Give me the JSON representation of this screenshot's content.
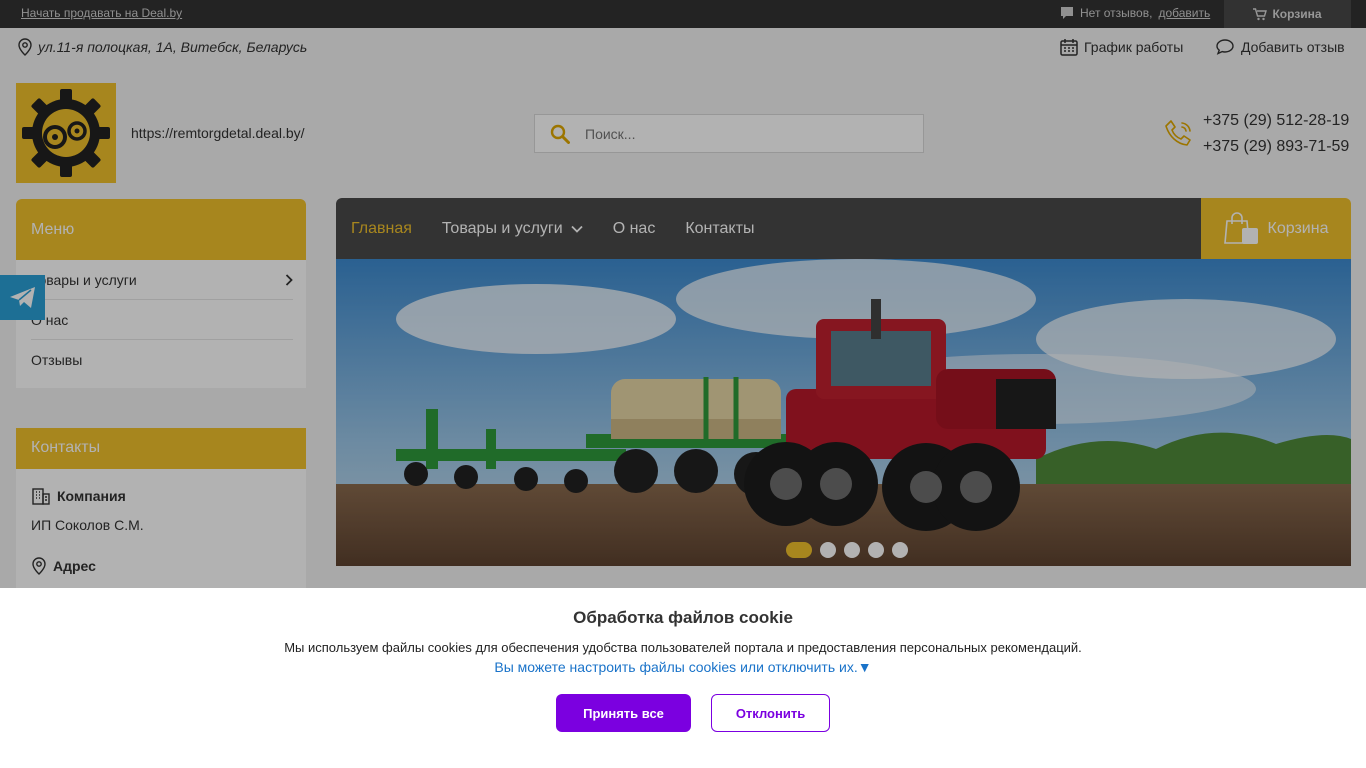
{
  "topbar": {
    "sell_link": "Начать продавать на Deal.by",
    "reviews_text": "Нет отзывов,",
    "reviews_add": "добавить",
    "cart": "Корзина"
  },
  "header": {
    "address": "ул.11-я полоцкая, 1А, Витебск, Беларусь",
    "schedule": "График работы",
    "add_review": "Добавить отзыв",
    "site_url": "https://remtorgdetal.deal.by/",
    "search_placeholder": "Поиск...",
    "phones": [
      "+375 (29) 512-28-19",
      "+375 (29) 893-71-59"
    ]
  },
  "sidebar": {
    "menu_title": "Меню",
    "items": [
      {
        "label": "Товары и услуги"
      },
      {
        "label": "О нас"
      },
      {
        "label": "Отзывы"
      }
    ],
    "contacts_title": "Контакты",
    "company_label": "Компания",
    "company_value": "ИП Соколов С.М.",
    "address_label": "Адрес"
  },
  "nav": {
    "items": [
      "Главная",
      "Товары и услуги",
      "О нас",
      "Контакты"
    ],
    "cart": "Корзина"
  },
  "banner": {
    "slides": 5,
    "active_slide": 1
  },
  "cookie": {
    "title": "Обработка файлов cookie",
    "text": "Мы используем файлы cookies для обеспечения удобства пользователей портала и предоставления персональных рекомендаций.",
    "link": "Вы можете настроить файлы cookies или отключить их.▼",
    "accept": "Принять все",
    "decline": "Отклонить"
  },
  "colors": {
    "accent": "#f0c02c",
    "nav_bg": "#4a4a4a",
    "cookie_button": "#7b00e0",
    "link": "#1a73c9"
  }
}
